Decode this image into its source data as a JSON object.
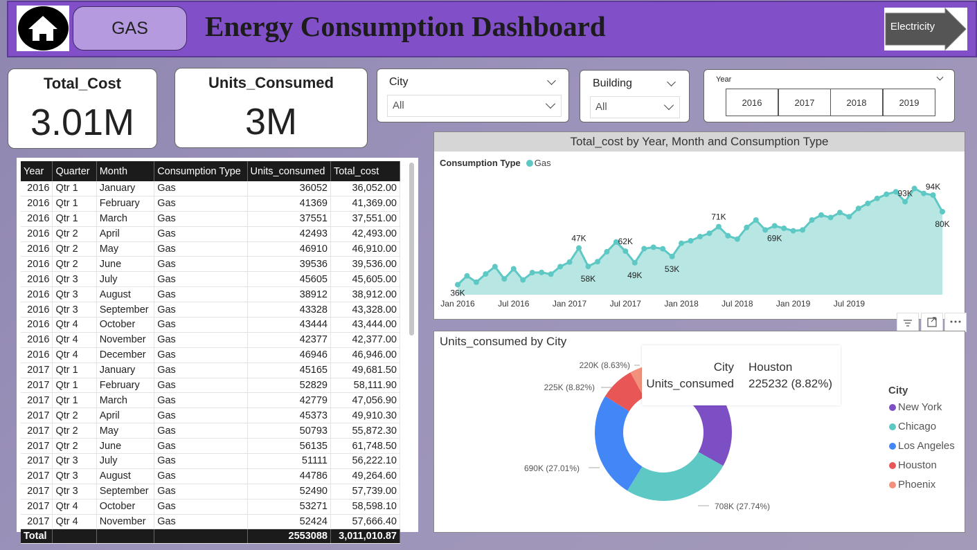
{
  "header": {
    "home_label": "home",
    "gas_label": "GAS",
    "title": "Energy Consumption Dashboard",
    "electricity_label": "Electricity"
  },
  "cards": {
    "total_cost_title": "Total_Cost",
    "total_cost_value": "3.01M",
    "units_title": "Units_Consumed",
    "units_value": "3M"
  },
  "slicers": {
    "city_label": "City",
    "city_value": "All",
    "building_label": "Building",
    "building_value": "All",
    "year_label": "Year",
    "years": [
      "2016",
      "2017",
      "2018",
      "2019"
    ]
  },
  "table": {
    "columns": [
      "Year",
      "Quarter",
      "Month",
      "Consumption Type",
      "Units_consumed",
      "Total_cost"
    ],
    "rows": [
      [
        "2016",
        "Qtr 1",
        "January",
        "Gas",
        "36052",
        "36,052.00"
      ],
      [
        "2016",
        "Qtr 1",
        "February",
        "Gas",
        "41369",
        "41,369.00"
      ],
      [
        "2016",
        "Qtr 1",
        "March",
        "Gas",
        "37551",
        "37,551.00"
      ],
      [
        "2016",
        "Qtr 2",
        "April",
        "Gas",
        "42493",
        "42,493.00"
      ],
      [
        "2016",
        "Qtr 2",
        "May",
        "Gas",
        "46910",
        "46,910.00"
      ],
      [
        "2016",
        "Qtr 2",
        "June",
        "Gas",
        "39536",
        "39,536.00"
      ],
      [
        "2016",
        "Qtr 3",
        "July",
        "Gas",
        "45605",
        "45,605.00"
      ],
      [
        "2016",
        "Qtr 3",
        "August",
        "Gas",
        "38912",
        "38,912.00"
      ],
      [
        "2016",
        "Qtr 3",
        "September",
        "Gas",
        "43328",
        "43,328.00"
      ],
      [
        "2016",
        "Qtr 4",
        "October",
        "Gas",
        "43444",
        "43,444.00"
      ],
      [
        "2016",
        "Qtr 4",
        "November",
        "Gas",
        "42377",
        "42,377.00"
      ],
      [
        "2016",
        "Qtr 4",
        "December",
        "Gas",
        "46946",
        "46,946.00"
      ],
      [
        "2017",
        "Qtr 1",
        "January",
        "Gas",
        "45165",
        "49,681.50"
      ],
      [
        "2017",
        "Qtr 1",
        "February",
        "Gas",
        "52829",
        "58,111.90"
      ],
      [
        "2017",
        "Qtr 1",
        "March",
        "Gas",
        "42779",
        "47,056.90"
      ],
      [
        "2017",
        "Qtr 2",
        "April",
        "Gas",
        "45373",
        "49,910.30"
      ],
      [
        "2017",
        "Qtr 2",
        "May",
        "Gas",
        "50793",
        "55,872.30"
      ],
      [
        "2017",
        "Qtr 2",
        "June",
        "Gas",
        "56135",
        "61,748.50"
      ],
      [
        "2017",
        "Qtr 3",
        "July",
        "Gas",
        "51111",
        "56,222.10"
      ],
      [
        "2017",
        "Qtr 3",
        "August",
        "Gas",
        "44786",
        "49,264.60"
      ],
      [
        "2017",
        "Qtr 3",
        "September",
        "Gas",
        "52490",
        "57,739.00"
      ],
      [
        "2017",
        "Qtr 4",
        "October",
        "Gas",
        "53271",
        "58,598.10"
      ],
      [
        "2017",
        "Qtr 4",
        "November",
        "Gas",
        "52424",
        "57,666.40"
      ]
    ],
    "total_label": "Total",
    "total_units": "2553088",
    "total_cost": "3,011,010.87"
  },
  "colors": {
    "header": "#8150c9",
    "gas": "#5ec8c4",
    "new_york": "#7c4fc5",
    "chicago": "#5ec8c4",
    "los_angeles": "#4287f5",
    "houston": "#e85656",
    "phoenix": "#f2917b"
  },
  "chart_data": [
    {
      "type": "area",
      "title": "Total_cost by Year, Month and Consumption Type",
      "legend_title": "Consumption Type",
      "series": [
        {
          "name": "Gas",
          "values": [
            36052,
            41369,
            37551,
            42493,
            46910,
            39536,
            45605,
            38912,
            43328,
            43444,
            42377,
            46946,
            49681,
            58112,
            47057,
            49910,
            55872,
            61748,
            56222,
            49265,
            57739,
            58598,
            57666,
            53000,
            61000,
            62500,
            65000,
            67000,
            71000,
            65500,
            63500,
            70500,
            75000,
            69000,
            71500,
            70000,
            68500,
            69000,
            75000,
            78000,
            76500,
            79500,
            77000,
            82000,
            85000,
            88000,
            90500,
            92000,
            86000,
            94000,
            91000,
            90000,
            80000
          ]
        }
      ],
      "x_ticks": [
        "Jan 2016",
        "Jul 2016",
        "Jan 2017",
        "Jul 2017",
        "Jan 2018",
        "Jul 2018",
        "Jan 2019",
        "Jul 2019"
      ],
      "labels": [
        "36K",
        "47K",
        "58K",
        "62K",
        "49K",
        "53K",
        "71K",
        "69K",
        "93K",
        "94K",
        "80K"
      ]
    },
    {
      "type": "pie",
      "title": "Units_consumed by City",
      "legend_title": "City",
      "categories": [
        "New York",
        "Chicago",
        "Los Angeles",
        "Houston",
        "Phoenix"
      ],
      "values": [
        913000,
        708000,
        690000,
        225232,
        220000
      ],
      "slice_labels": [
        "708K (27.74%)",
        "690K (27.01%)",
        "225K (8.82%)",
        "220K (8.63%)"
      ],
      "tooltip": {
        "k1": "City",
        "v1": "Houston",
        "k2": "Units_consumed",
        "v2": "225232 (8.82%)"
      }
    }
  ]
}
